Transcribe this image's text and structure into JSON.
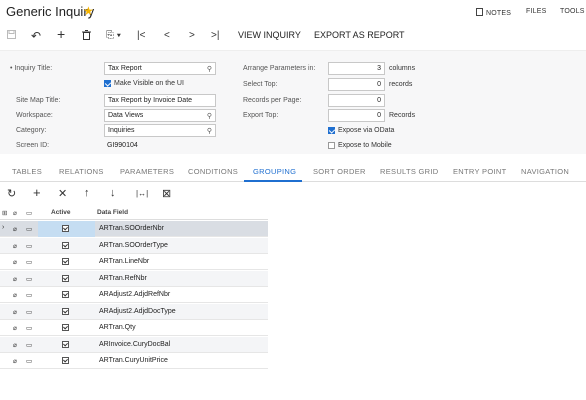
{
  "header": {
    "title": "Generic Inquiry",
    "star": "★",
    "notes": "NOTES",
    "files": "FILES",
    "tools": "TOOLS"
  },
  "toolbar": {
    "save_icon": "💾",
    "undo_icon": "↶",
    "add_icon": "+",
    "delete_icon": "🗑",
    "copy_icon": "⎘ ▾",
    "first_icon": "|<",
    "prev_icon": "<",
    "next_icon": ">",
    "last_icon": ">|",
    "view_inquiry": "VIEW INQUIRY",
    "export_report": "EXPORT AS REPORT"
  },
  "form": {
    "inquiry_title_label": "• Inquiry Title:",
    "inquiry_title_value": "Tax Report",
    "visible_on_ui_label": "Make Visible on the UI",
    "visible_on_ui": true,
    "site_map_title_label": "Site Map Title:",
    "site_map_title_value": "Tax Report by Invoice Date",
    "workspace_label": "Workspace:",
    "workspace_value": "Data Views",
    "category_label": "Category:",
    "category_value": "Inquiries",
    "screen_id_label": "Screen ID:",
    "screen_id_value": "GI990104",
    "arrange_label": "Arrange Parameters in:",
    "arrange_value": "3",
    "arrange_unit": "columns",
    "select_top_label": "Select Top:",
    "select_top_value": "0",
    "select_top_unit": "records",
    "records_per_page_label": "Records per Page:",
    "records_per_page_value": "0",
    "export_top_label": "Export Top:",
    "export_top_value": "0",
    "export_top_unit": "Records",
    "expose_odata_label": "Expose via OData",
    "expose_odata": true,
    "expose_mobile_label": "Expose to Mobile",
    "expose_mobile": false
  },
  "tabs": [
    "TABLES",
    "RELATIONS",
    "PARAMETERS",
    "CONDITIONS",
    "GROUPING",
    "SORT ORDER",
    "RESULTS GRID",
    "ENTRY POINT",
    "NAVIGATION"
  ],
  "active_tab": "GROUPING",
  "gridbar": {
    "refresh_icon": "↻",
    "add_icon": "+",
    "delete_icon": "✕",
    "up_icon": "↑",
    "down_icon": "↓",
    "fit_icon": "|↔|",
    "export_icon": "⊠"
  },
  "grid": {
    "headers": {
      "active": "Active",
      "data_field": "Data Field"
    },
    "rows": [
      {
        "data_field": "ARTran.SOOrderNbr",
        "active": true
      },
      {
        "data_field": "ARTran.SOOrderType",
        "active": true
      },
      {
        "data_field": "ARTran.LineNbr",
        "active": true
      },
      {
        "data_field": "ARTran.RefNbr",
        "active": true
      },
      {
        "data_field": "ARAdjust2.AdjdRefNbr",
        "active": true
      },
      {
        "data_field": "ARAdjust2.AdjdDocType",
        "active": true
      },
      {
        "data_field": "ARTran.Qty",
        "active": true
      },
      {
        "data_field": "ARInvoice.CuryDocBal",
        "active": true
      },
      {
        "data_field": "ARTran.CuryUnitPrice",
        "active": true
      }
    ]
  }
}
